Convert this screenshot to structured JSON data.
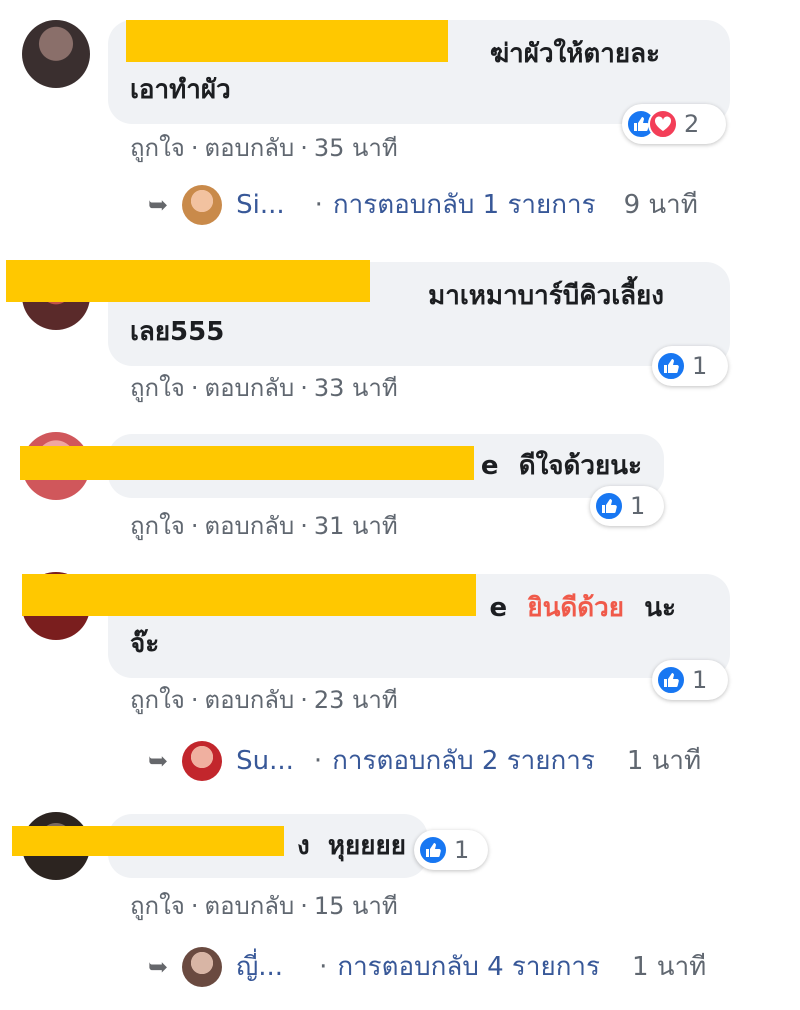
{
  "comments": [
    {
      "text_line1": "ฆ่าผัวให้ตายละ",
      "text_line2": "เอาทำผัว",
      "like_label": "ถูกใจ",
      "reply_label": "ตอบกลับ",
      "time": "35 นาที",
      "reaction_count": "2",
      "reply_preview": {
        "name": "Si...",
        "text": "การตอบกลับ 1 รายการ",
        "time": "9 นาที"
      }
    },
    {
      "text_line1": "มาเหมาบาร์บีคิวเลี้ยง",
      "text_line2": "เลย555",
      "like_label": "ถูกใจ",
      "reply_label": "ตอบกลับ",
      "time": "33 นาที",
      "reaction_count": "1"
    },
    {
      "text_prefix": "e",
      "text_line1": "ดีใจด้วยนะ",
      "like_label": "ถูกใจ",
      "reply_label": "ตอบกลับ",
      "time": "31 นาที",
      "reaction_count": "1"
    },
    {
      "text_prefix": "e",
      "text_highlight": "ยินดีด้วย",
      "text_line1_end": "นะ",
      "text_line2": "จ๊ะ",
      "like_label": "ถูกใจ",
      "reply_label": "ตอบกลับ",
      "time": "23 นาที",
      "reaction_count": "1",
      "reply_preview": {
        "name": "Su...",
        "text": "การตอบกลับ 2 รายการ",
        "time": "1 นาที"
      }
    },
    {
      "text_prefix": "ง",
      "text_line1": "หุยยยย",
      "like_label": "ถูกใจ",
      "reply_label": "ตอบกลับ",
      "time": "15 นาที",
      "reaction_count": "1",
      "reply_preview": {
        "name": "ญี่...",
        "text": "การตอบกลับ 4 รายการ",
        "time": "1 นาที"
      }
    }
  ],
  "colors": {
    "bubble": "#f0f2f5",
    "redaction": "#ffc800",
    "like_blue": "#1877f2",
    "love_red": "#f33e58",
    "highlight_text": "#f05a4a",
    "meta_gray": "#606770"
  },
  "icons": {
    "like": "like-icon",
    "love": "love-icon",
    "reply_arrow": "reply-arrow-icon"
  }
}
